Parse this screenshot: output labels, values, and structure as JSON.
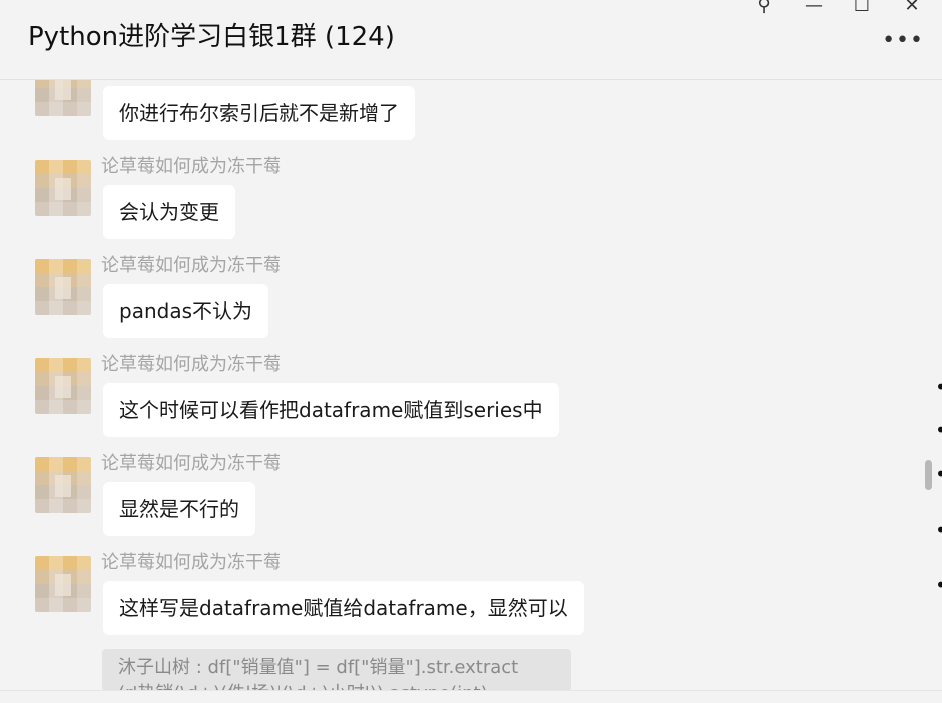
{
  "header": {
    "title": "Python进阶学习白银1群 (124)",
    "pin_icon": "pin-icon",
    "minimize_icon": "minimize-icon",
    "maximize_icon": "maximize-icon",
    "close_icon": "close-icon",
    "more_icon": "more-icon"
  },
  "messages": [
    {
      "sender": "",
      "text": "你进行布尔索引后就不是新增了"
    },
    {
      "sender": "论草莓如何成为冻干莓",
      "text": "会认为变更"
    },
    {
      "sender": "论草莓如何成为冻干莓",
      "text": "pandas不认为"
    },
    {
      "sender": "论草莓如何成为冻干莓",
      "text": "这个时候可以看作把dataframe赋值到series中"
    },
    {
      "sender": "论草莓如何成为冻干莓",
      "text": "显然是不行的"
    },
    {
      "sender": "论草莓如何成为冻干莓",
      "text": "这样写是dataframe赋值给dataframe，显然可以"
    }
  ],
  "quote": {
    "text": "沐子山树 : df[\"销量值\"] = df[\"销量\"].str.extract(r'热销(\\d+)(件|场)|(\\d+)小时')).astype(int)"
  },
  "colors": {
    "background": "#f3f3f3",
    "bubble": "#ffffff",
    "sender_text": "#a5a5a5",
    "quote_bg": "#e3e3e3"
  }
}
